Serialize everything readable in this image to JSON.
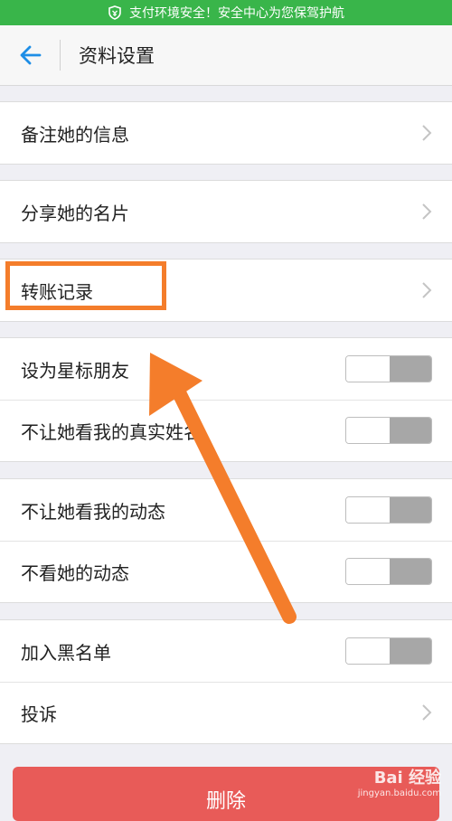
{
  "status_bar": {
    "text": "支付环境安全！安全中心为您保驾护航"
  },
  "nav": {
    "title": "资料设置"
  },
  "groups": [
    {
      "rows": [
        {
          "label": "备注她的信息"
        }
      ]
    },
    {
      "rows": [
        {
          "label": "分享她的名片"
        }
      ]
    },
    {
      "rows": [
        {
          "label": "转账记录"
        }
      ]
    },
    {
      "rows": [
        {
          "label": "设为星标朋友"
        },
        {
          "label": "不让她看我的真实姓名"
        }
      ]
    },
    {
      "rows": [
        {
          "label": "不让她看我的动态"
        },
        {
          "label": "不看她的动态"
        }
      ]
    },
    {
      "rows": [
        {
          "label": "加入黑名单"
        },
        {
          "label": "投诉"
        }
      ]
    }
  ],
  "delete_button": {
    "label": "删除"
  },
  "watermark": {
    "brand": "Bai 经验",
    "site": "jingyan.baidu.com"
  },
  "colors": {
    "status_green": "#39b54a",
    "back_arrow_blue": "#1e8ee6",
    "annotation_orange": "#f47d2b",
    "delete_red": "#e85b58"
  }
}
